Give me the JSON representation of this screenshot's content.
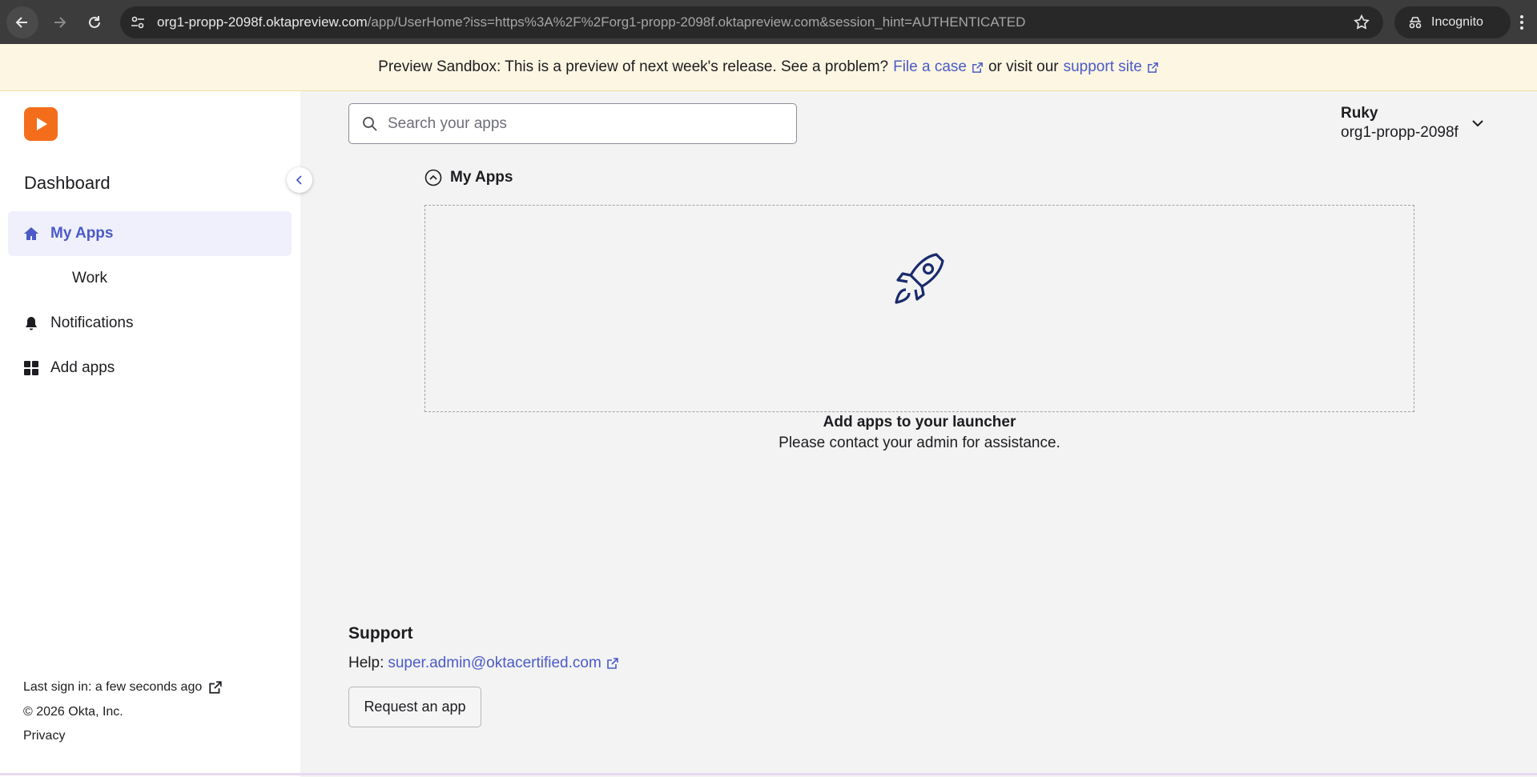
{
  "browser": {
    "url_host": "org1-propp-2098f.oktapreview.com",
    "url_path": "/app/UserHome?iss=https%3A%2F%2Forg1-propp-2098f.oktapreview.com&session_hint=AUTHENTICATED",
    "incognito_label": "Incognito"
  },
  "banner": {
    "text": "Preview Sandbox: This is a preview of next week's release. See a problem?",
    "link1": "File a case",
    "middle": "or visit our",
    "link2": "support site"
  },
  "sidebar": {
    "title": "Dashboard",
    "items": [
      {
        "label": "My Apps"
      },
      {
        "label": "Work"
      },
      {
        "label": "Notifications"
      },
      {
        "label": "Add apps"
      }
    ],
    "footer": {
      "last_sign_in": "Last sign in: a few seconds ago",
      "copyright": "© 2026 Okta, Inc.",
      "privacy": "Privacy"
    }
  },
  "search": {
    "placeholder": "Search your apps"
  },
  "user": {
    "name": "Ruky",
    "org": "org1-propp-2098f"
  },
  "section": {
    "title": "My Apps",
    "empty_title": "Add apps to your launcher",
    "empty_sub": "Please contact your admin for assistance."
  },
  "support": {
    "title": "Support",
    "help_label": "Help:",
    "email": "super.admin@oktacertified.com",
    "request_button": "Request an app"
  },
  "colors": {
    "accent": "#4b5bc7",
    "logo": "#f46d1a",
    "banner": "#fcf6e2"
  }
}
